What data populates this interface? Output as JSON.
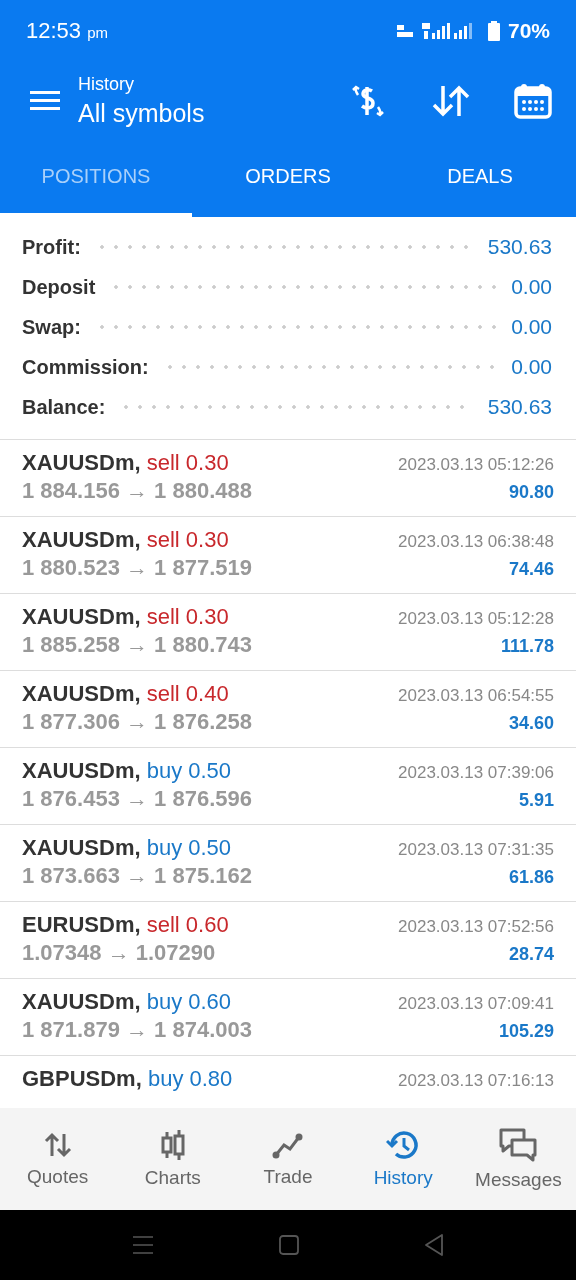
{
  "status_bar": {
    "time": "12:53",
    "ampm": "pm",
    "battery": "70%"
  },
  "header": {
    "title": "History",
    "subtitle": "All symbols"
  },
  "tabs": [
    {
      "label": "POSITIONS",
      "selected": true
    },
    {
      "label": "ORDERS",
      "selected": false
    },
    {
      "label": "DEALS",
      "selected": false
    }
  ],
  "summary": [
    {
      "label": "Profit:",
      "value": "530.63"
    },
    {
      "label": "Deposit",
      "value": "0.00"
    },
    {
      "label": "Swap:",
      "value": "0.00"
    },
    {
      "label": "Commission:",
      "value": "0.00"
    },
    {
      "label": "Balance:",
      "value": "530.63"
    }
  ],
  "trades": [
    {
      "symbol": "XAUUSDm,",
      "kind": "sell",
      "deal": "sell 0.30",
      "time": "2023.03.13 05:12:26",
      "prices": "1 884.156 → 1 880.488",
      "profit": "90.80"
    },
    {
      "symbol": "XAUUSDm,",
      "kind": "sell",
      "deal": "sell 0.30",
      "time": "2023.03.13 06:38:48",
      "prices": "1 880.523 → 1 877.519",
      "profit": "74.46"
    },
    {
      "symbol": "XAUUSDm,",
      "kind": "sell",
      "deal": "sell 0.30",
      "time": "2023.03.13 05:12:28",
      "prices": "1 885.258 → 1 880.743",
      "profit": "111.78"
    },
    {
      "symbol": "XAUUSDm,",
      "kind": "sell",
      "deal": "sell 0.40",
      "time": "2023.03.13 06:54:55",
      "prices": "1 877.306 → 1 876.258",
      "profit": "34.60"
    },
    {
      "symbol": "XAUUSDm,",
      "kind": "buy",
      "deal": "buy 0.50",
      "time": "2023.03.13 07:39:06",
      "prices": "1 876.453 → 1 876.596",
      "profit": "5.91"
    },
    {
      "symbol": "XAUUSDm,",
      "kind": "buy",
      "deal": "buy 0.50",
      "time": "2023.03.13 07:31:35",
      "prices": "1 873.663 → 1 875.162",
      "profit": "61.86"
    },
    {
      "symbol": "EURUSDm,",
      "kind": "sell",
      "deal": "sell 0.60",
      "time": "2023.03.13 07:52:56",
      "prices": "1.07348 → 1.07290",
      "profit": "28.74"
    },
    {
      "symbol": "XAUUSDm,",
      "kind": "buy",
      "deal": "buy 0.60",
      "time": "2023.03.13 07:09:41",
      "prices": "1 871.879 → 1 874.003",
      "profit": "105.29"
    },
    {
      "symbol": "GBPUSDm,",
      "kind": "buy",
      "deal": "buy 0.80",
      "time": "2023.03.13 07:16:13"
    }
  ],
  "bottom_nav": [
    {
      "label": "Quotes",
      "kind": "quotes",
      "selected": false
    },
    {
      "label": "Charts",
      "kind": "charts",
      "selected": false
    },
    {
      "label": "Trade",
      "kind": "trade",
      "selected": false
    },
    {
      "label": "History",
      "kind": "history",
      "selected": true
    },
    {
      "label": "Messages",
      "kind": "messages",
      "selected": false
    }
  ]
}
